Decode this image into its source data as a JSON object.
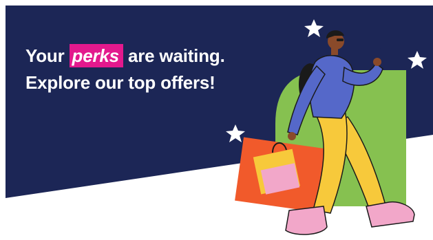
{
  "banner": {
    "headline": {
      "line1_before": "Your",
      "highlight": "perks",
      "line1_after": "are waiting.",
      "line2": "Explore our top offers!"
    },
    "colors": {
      "background_navy": "#1c2656",
      "highlight_pink": "#e3198d",
      "accent_green": "#86c150",
      "jacket_blue": "#5568c9",
      "pants_yellow": "#f7c93b",
      "bag_orange": "#f15a2b",
      "shoes_pink": "#f2a7c9"
    },
    "illustration": {
      "subject": "person walking with shopping bags while using phone",
      "icons": [
        "star-icon",
        "star-icon",
        "star-icon"
      ]
    }
  }
}
